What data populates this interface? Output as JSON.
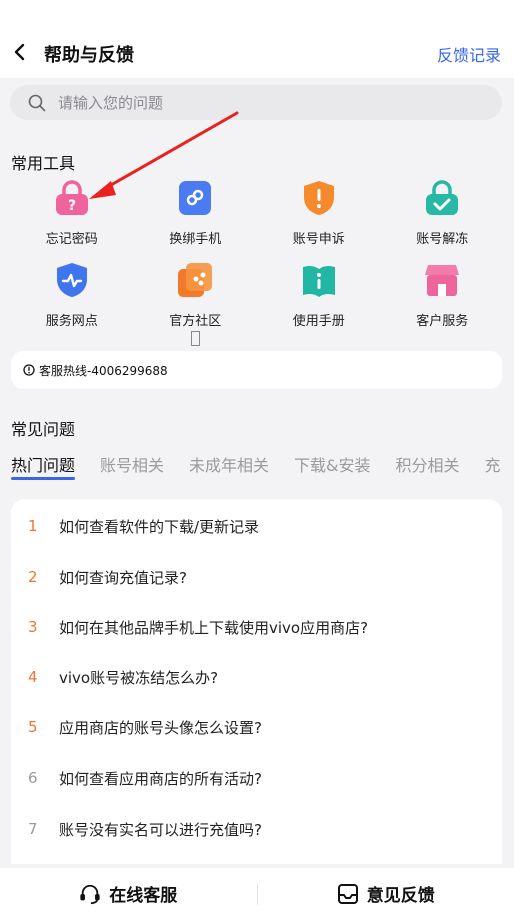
{
  "header": {
    "title": "帮助与反馈",
    "feedback_record": "反馈记录"
  },
  "search": {
    "placeholder": "请输入您的问题"
  },
  "tools": {
    "title": "常用工具",
    "items": [
      {
        "label": "忘记密码",
        "icon": "lock-question-icon",
        "color": "#f0649c"
      },
      {
        "label": "换绑手机",
        "icon": "phone-link-icon",
        "color": "#4a7bf0"
      },
      {
        "label": "账号申诉",
        "icon": "shield-alert-icon",
        "color": "#f58a2c"
      },
      {
        "label": "账号解冻",
        "icon": "lock-check-icon",
        "color": "#27b8a6"
      },
      {
        "label": "服务网点",
        "icon": "shield-pulse-icon",
        "color": "#3f76f0"
      },
      {
        "label": "官方社区",
        "icon": "community-icon",
        "color": "#f27a2a"
      },
      {
        "label": "使用手册",
        "icon": "book-info-icon",
        "color": "#22b6a4"
      },
      {
        "label": "客户服务",
        "icon": "store-icon",
        "color": "#f0649c"
      }
    ]
  },
  "hotline": {
    "text": "客服热线-4006299688"
  },
  "faq": {
    "title": "常见问题",
    "tabs": [
      "热门问题",
      "账号相关",
      "未成年相关",
      "下载&安装",
      "积分相关",
      "充"
    ],
    "items": [
      {
        "num": "1",
        "text": "如何查看软件的下载/更新记录"
      },
      {
        "num": "2",
        "text": "如何查询充值记录?"
      },
      {
        "num": "3",
        "text": "如何在其他品牌手机上下载使用vivo应用商店?"
      },
      {
        "num": "4",
        "text": "vivo账号被冻结怎么办?"
      },
      {
        "num": "5",
        "text": "应用商店的账号头像怎么设置?"
      },
      {
        "num": "6",
        "text": "如何查看应用商店的所有活动?"
      },
      {
        "num": "7",
        "text": "账号没有实名可以进行充值吗?"
      }
    ]
  },
  "bottom": {
    "online_service": "在线客服",
    "feedback": "意见反馈"
  },
  "colors": {
    "accent": "#3a66e6",
    "hot_number": "#f07533",
    "annotation_arrow": "#e8231f"
  }
}
